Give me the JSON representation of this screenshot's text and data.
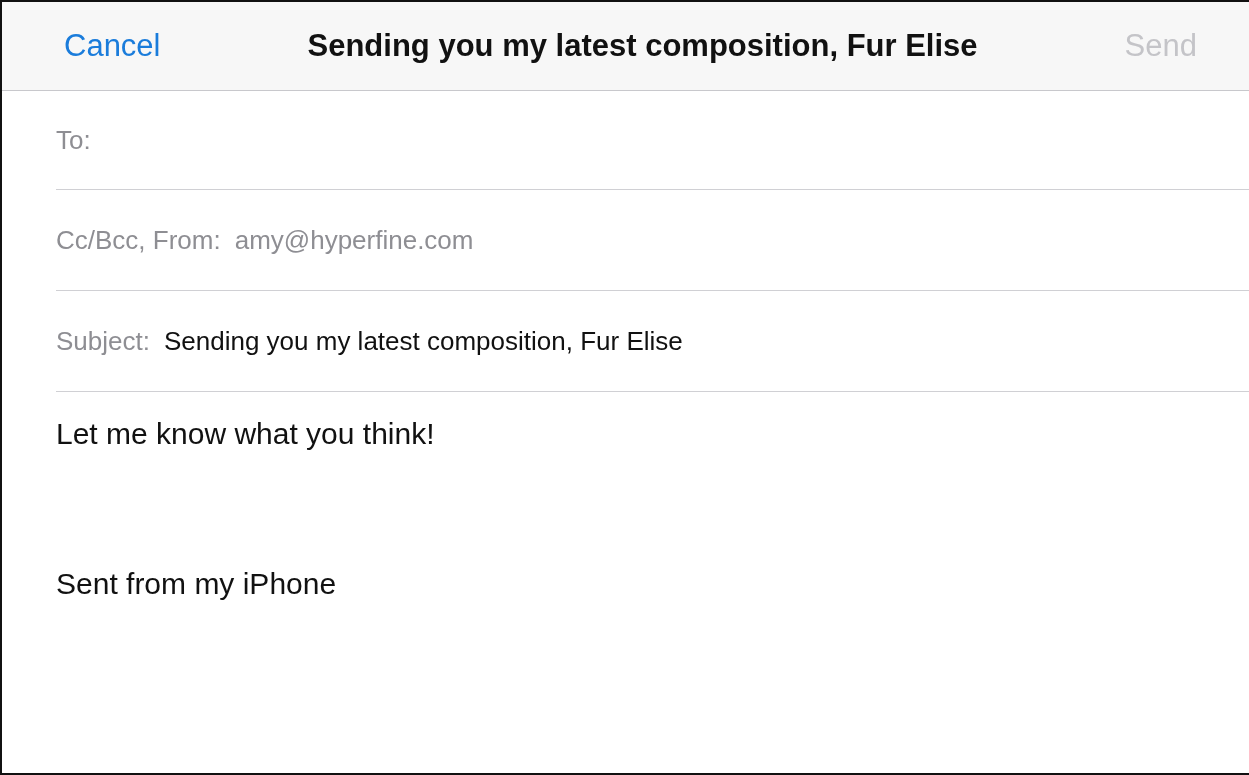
{
  "nav": {
    "cancel": "Cancel",
    "title": "Sending you my latest composition, Fur Elise",
    "send": {
      "label": "Send",
      "disabled": true
    }
  },
  "fields": [
    {
      "kind": "to",
      "label": "To:"
    },
    {
      "kind": "from",
      "label": "Cc/Bcc, From:",
      "value": "amy@hyperfine.com"
    },
    {
      "kind": "subject",
      "label": "Subject:",
      "value": "Sending you my latest composition, Fur Elise"
    }
  ],
  "body": [
    "Let me know what you think!",
    "Sent from my iPhone"
  ]
}
